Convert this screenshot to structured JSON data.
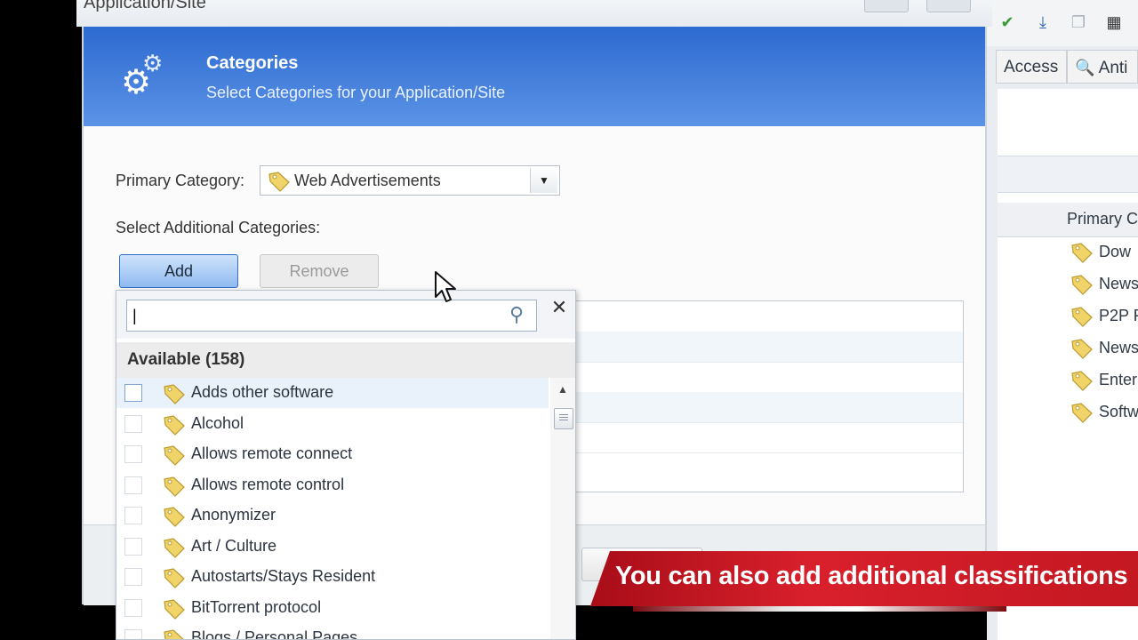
{
  "window": {
    "title": "Application/Site"
  },
  "header": {
    "title": "Categories",
    "subtitle": "Select Categories for your Application/Site"
  },
  "form": {
    "primary_label": "Primary Category:",
    "primary_value": "Web Advertisements",
    "additional_label": "Select Additional Categories:",
    "add_label": "Add",
    "remove_label": "Remove"
  },
  "popup": {
    "search_value": "|",
    "available_label": "Available (158)",
    "items": [
      "Adds other software",
      "Alcohol",
      "Allows remote connect",
      "Allows remote control",
      "Anonymizer",
      "Art / Culture",
      "Autostarts/Stays Resident",
      "BitTorrent protocol",
      "Blogs / Personal Pages"
    ]
  },
  "background_app": {
    "tab_access": "Access",
    "tab_anti": "Anti",
    "column_header": "Primary C",
    "rows": [
      "Dow",
      "News",
      "P2P F",
      "News",
      "Enter",
      "Softw"
    ]
  },
  "caption": {
    "text": "You can also add additional classifications"
  },
  "colors": {
    "header_blue": "#2d6ad0",
    "tag_yellow": "#f0d46a",
    "caption_red": "#c41822"
  },
  "icons": {
    "gear": "gear-icon",
    "tag": "tag-icon",
    "search": "search-icon",
    "close": "close-icon",
    "cursor": "mouse-pointer-icon"
  }
}
